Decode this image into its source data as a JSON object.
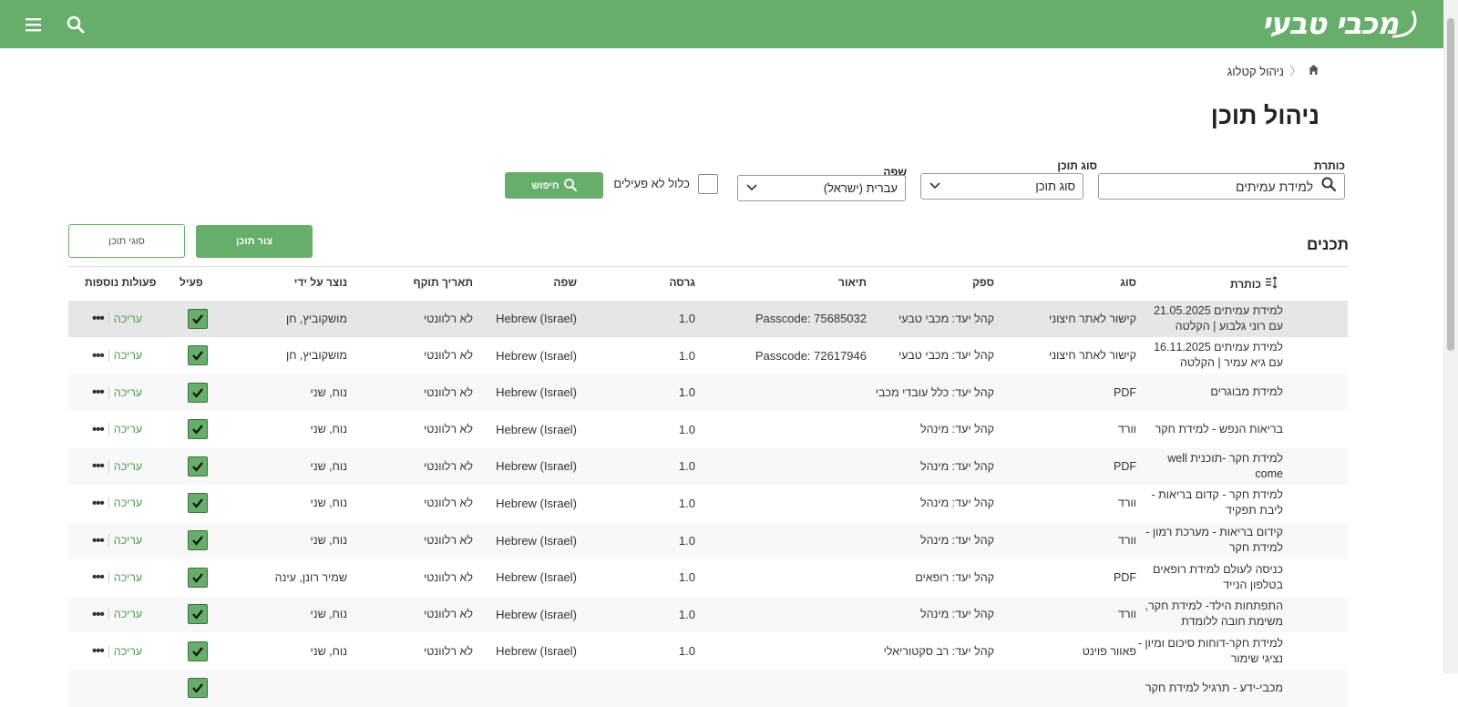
{
  "header": {
    "logo_text": "מכבי טבעי"
  },
  "breadcrumb": {
    "page": "ניהול קטלוג"
  },
  "page": {
    "title": "ניהול תוכן"
  },
  "filters": {
    "title_label": "כותרת",
    "title_value": "למידת עמיתים",
    "content_type_label": "סוג תוכן",
    "content_type_value": "סוג תוכן",
    "language_label": "שפה",
    "language_value": "עברית (ישראל)",
    "include_inactive_label": "כלול לא פעילים",
    "search_button": "חיפוש"
  },
  "section": {
    "title": "תכנים",
    "create_button": "צור תוכן",
    "content_types_button": "סוגי תוכן"
  },
  "table": {
    "columns": {
      "title": "כותרת",
      "type": "סוג",
      "source": "ספק",
      "description": "תיאור",
      "version": "גרסה",
      "language": "שפה",
      "expiry": "תאריך תוקף",
      "created_by": "נוצר על ידי",
      "active": "פעיל",
      "actions": "פעולות נוספות"
    },
    "edit_label": "עריכה",
    "more_label": "•••",
    "rows": [
      {
        "title": "למידת עמיתים 21.05.2025 עם רוני גלבוע | הקלטה",
        "type": "קישור לאתר חיצוני",
        "source": "קהל יעד: מכבי טבעי",
        "description": "Passcode: 75685032",
        "version": "1.0",
        "language": "Hebrew (Israel)",
        "expiry": "לא רלוונטי",
        "created_by": "מושקוביץ, חן"
      },
      {
        "title": "למידת עמיתים 16.11.2025 עם גיא עמיר | הקלטה",
        "type": "קישור לאתר חיצוני",
        "source": "קהל יעד: מכבי טבעי",
        "description": "Passcode: 72617946",
        "version": "1.0",
        "language": "Hebrew (Israel)",
        "expiry": "לא רלוונטי",
        "created_by": "מושקוביץ, חן"
      },
      {
        "title": "למידת מבוגרים",
        "type": "PDF",
        "source": "קהל יעד: כלל עובדי מכבי",
        "description": "",
        "version": "1.0",
        "language": "Hebrew (Israel)",
        "expiry": "לא רלוונטי",
        "created_by": "נוח, שני"
      },
      {
        "title": "בריאות הנפש - למידת חקר",
        "type": "וורד",
        "source": "קהל יעד: מינהל",
        "description": "",
        "version": "1.0",
        "language": "Hebrew (Israel)",
        "expiry": "לא רלוונטי",
        "created_by": "נוח, שני"
      },
      {
        "title": "למידת חקר -תוכנית well come",
        "type": "PDF",
        "source": "קהל יעד: מינהל",
        "description": "",
        "version": "1.0",
        "language": "Hebrew (Israel)",
        "expiry": "לא רלוונטי",
        "created_by": "נוח, שני"
      },
      {
        "title": "למידת חקר - קדום בריאות - ליבת תפקיד",
        "type": "וורד",
        "source": "קהל יעד: מינהל",
        "description": "",
        "version": "1.0",
        "language": "Hebrew (Israel)",
        "expiry": "לא רלוונטי",
        "created_by": "נוח, שני"
      },
      {
        "title": "קידום בריאות - מערכת רמון - למידת חקר",
        "type": "וורד",
        "source": "קהל יעד: מינהל",
        "description": "",
        "version": "1.0",
        "language": "Hebrew (Israel)",
        "expiry": "לא רלוונטי",
        "created_by": "נוח, שני"
      },
      {
        "title": "כניסה לעולם למידת רופאים בטלפון הנייד",
        "type": "PDF",
        "source": "קהל יעד: רופאים",
        "description": "",
        "version": "1.0",
        "language": "Hebrew (Israel)",
        "expiry": "לא רלוונטי",
        "created_by": "שמיר רונן, עינה"
      },
      {
        "title": "התפתחות הילד- למידת חקר, משימת חובה ללומדת",
        "type": "וורד",
        "source": "קהל יעד: מינהל",
        "description": "",
        "version": "1.0",
        "language": "Hebrew (Israel)",
        "expiry": "לא רלוונטי",
        "created_by": "נוח, שני"
      },
      {
        "title": "למידת חקר-דוחות סיכום ומיון - נציגי שימור",
        "type": "פאוור פוינט",
        "source": "קהל יעד: רב סקטוריאלי",
        "description": "",
        "version": "1.0",
        "language": "Hebrew (Israel)",
        "expiry": "לא רלוונטי",
        "created_by": "נוח, שני"
      },
      {
        "title": "מכבי-ידע - תרגיל למידת חקר",
        "type": "",
        "source": "",
        "description": "",
        "version": "",
        "language": "",
        "expiry": "",
        "created_by": ""
      }
    ]
  }
}
